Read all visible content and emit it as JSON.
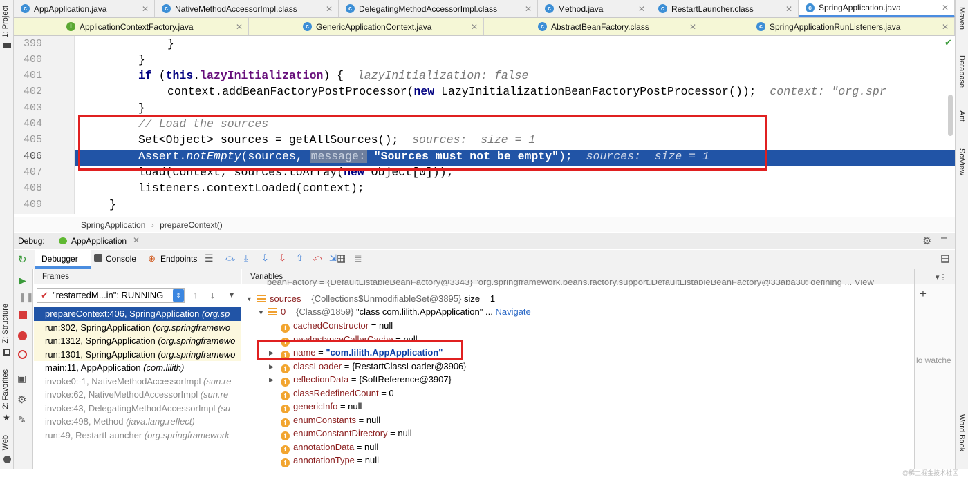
{
  "tabs_row1": [
    {
      "label": "AppApplication.java",
      "icon": "class-icon",
      "active": false
    },
    {
      "label": "NativeMethodAccessorImpl.class",
      "icon": "class-icon",
      "active": false
    },
    {
      "label": "DelegatingMethodAccessorImpl.class",
      "icon": "class-icon",
      "active": false
    },
    {
      "label": "Method.java",
      "icon": "class-icon",
      "active": false
    },
    {
      "label": "RestartLauncher.class",
      "icon": "class-icon",
      "active": false
    },
    {
      "label": "SpringApplication.java",
      "icon": "class-icon",
      "active": true
    }
  ],
  "tabs_row2": [
    {
      "label": "ApplicationContextFactory.java",
      "icon": "interface-icon"
    },
    {
      "label": "GenericApplicationContext.java",
      "icon": "class-icon"
    },
    {
      "label": "AbstractBeanFactory.class",
      "icon": "class-icon"
    },
    {
      "label": "SpringApplicationRunListeners.java",
      "icon": "class-icon"
    }
  ],
  "left_tools": {
    "project": "1: Project",
    "structure": "Z: Structure",
    "favorites": "2: Favorites",
    "web": "Web"
  },
  "right_tools": {
    "maven": "Maven",
    "database": "Database",
    "ant": "Ant",
    "sciview": "SciView",
    "wordbook": "Word Book"
  },
  "editor": {
    "line_numbers": [
      "399",
      "400",
      "401",
      "402",
      "403",
      "404",
      "405",
      "406",
      "407",
      "408",
      "409"
    ],
    "l399": "}",
    "l400": "}",
    "l401_kw1": "if",
    "l401_a": " (",
    "l401_this": "this",
    "l401_dot": ".",
    "l401_field": "lazyInitialization",
    "l401_b": ") {",
    "l401_hint": "lazyInitialization: false",
    "l402_a": "context.addBeanFactoryPostProcessor(",
    "l402_new": "new",
    "l402_b": " LazyInitializationBeanFactoryPostProcessor());",
    "l402_hint": "context: \"org.spr",
    "l403": "}",
    "l404": "// Load the sources",
    "l405": "Set<Object> sources = getAllSources();",
    "l405_hint": "sources:  size = 1",
    "l406_a": "Assert.",
    "l406_method": "notEmpty",
    "l406_b": "(sources, ",
    "l406_param": "message:",
    "l406_str": "\"Sources must not be empty\"",
    "l406_c": ");",
    "l406_hint": "sources:  size = 1",
    "l407_a": "load(context, sources.toArray(",
    "l407_new": "new",
    "l407_b": " Object[0]));",
    "l408": "listeners.contextLoaded(context);",
    "l409": "}"
  },
  "breadcrumb": {
    "class": "SpringApplication",
    "sep": "›",
    "method": "prepareContext()"
  },
  "debug": {
    "label": "Debug:",
    "session": "AppApplication",
    "tabs": [
      "Debugger",
      "Console",
      "Endpoints"
    ],
    "frames_title": "Frames",
    "variables_title": "Variables",
    "thread": "\"restartedM...in\": RUNNING",
    "frames": [
      {
        "m": "prepareContext:406, SpringApplication ",
        "p": "(org.sp",
        "kind": "sel"
      },
      {
        "m": "run:302, SpringApplication ",
        "p": "(org.springframewo",
        "kind": "user"
      },
      {
        "m": "run:1312, SpringApplication ",
        "p": "(org.springframewo",
        "kind": "user"
      },
      {
        "m": "run:1301, SpringApplication ",
        "p": "(org.springframewo",
        "kind": "user"
      },
      {
        "m": "main:11, AppApplication ",
        "p": "(com.lilith)",
        "kind": "normal"
      },
      {
        "m": "invoke0:-1, NativeMethodAccessorImpl ",
        "p": "(sun.re",
        "kind": "dim"
      },
      {
        "m": "invoke:62, NativeMethodAccessorImpl ",
        "p": "(sun.re",
        "kind": "dim"
      },
      {
        "m": "invoke:43, DelegatingMethodAccessorImpl ",
        "p": "(su",
        "kind": "dim"
      },
      {
        "m": "invoke:498, Method ",
        "p": "(java.lang.reflect)",
        "kind": "dim"
      },
      {
        "m": "run:49, RestartLauncher ",
        "p": "(org.springframework",
        "kind": "dim"
      }
    ],
    "cut_row": "beanFactory = {DefaultListableBeanFactory@3343} \"org.springframework.beans.factory.support.DefaultListableBeanFactory@33aba30: defining ... View",
    "sources_row": {
      "name": "sources",
      "value": "{Collections$UnmodifiableSet@3895}",
      "extra": "size = 1"
    },
    "elem_row": {
      "name": "0",
      "value": "{Class@1859}",
      "str": "\"class com.lilith.AppApplication\"",
      "more": "...",
      "nav": "Navigate"
    },
    "fields": [
      {
        "name": "cachedConstructor",
        "value": "null",
        "expand": false
      },
      {
        "name": "newInstanceCallerCache",
        "value": "null",
        "expand": false
      },
      {
        "name": "name",
        "value": "\"com.lilith.AppApplication\"",
        "expand": true,
        "string": true
      },
      {
        "name": "classLoader",
        "value": "{RestartClassLoader@3906}",
        "expand": true
      },
      {
        "name": "reflectionData",
        "value": "{SoftReference@3907}",
        "expand": true
      },
      {
        "name": "classRedefinedCount",
        "value": "0",
        "expand": false
      },
      {
        "name": "genericInfo",
        "value": "null",
        "expand": false
      },
      {
        "name": "enumConstants",
        "value": "null",
        "expand": false
      },
      {
        "name": "enumConstantDirectory",
        "value": "null",
        "expand": false
      },
      {
        "name": "annotationData",
        "value": "null",
        "expand": false
      },
      {
        "name": "annotationType",
        "value": "null",
        "expand": false
      }
    ],
    "watches_partial": "lo watche",
    "watermark": "@稀土掘金技术社区"
  }
}
